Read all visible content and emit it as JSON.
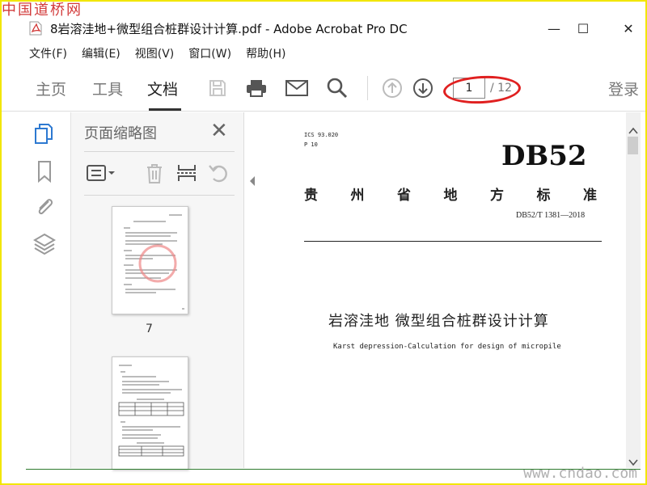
{
  "watermark": {
    "top": "中国道桥网",
    "bottom": "www.cndao.com"
  },
  "window": {
    "title": "8岩溶洼地+微型组合桩群设计计算.pdf - Adobe Acrobat Pro DC",
    "minimize": "—",
    "maximize": "☐",
    "close": "✕"
  },
  "menu": [
    "文件(F)",
    "编辑(E)",
    "视图(V)",
    "窗口(W)",
    "帮助(H)"
  ],
  "toolbar": {
    "tabs": [
      "主页",
      "工具",
      "文档"
    ],
    "active_tab": "文档",
    "current_page": "1",
    "total_pages": "/ 12",
    "login": "登录",
    "icons": [
      "save-icon",
      "print-icon",
      "email-icon",
      "search-icon",
      "page-up-icon",
      "page-down-icon"
    ]
  },
  "rail": {
    "icons": [
      "page-thumbnails-icon",
      "bookmarks-icon",
      "attachments-icon",
      "layers-icon"
    ]
  },
  "panel": {
    "title": "页面缩略图",
    "close": "✕",
    "thumb_label": "7",
    "tools": [
      "options-menu-icon",
      "delete-icon",
      "insert-page-icon",
      "rotate-icon"
    ]
  },
  "document": {
    "ics": "ICS 93.020",
    "p": "P 10",
    "code_big": "DB52",
    "std_name_chars": [
      "贵",
      "州",
      "省",
      "地",
      "方",
      "标",
      "准"
    ],
    "std_code": "DB52/T 1381—2018",
    "title_cn": "岩溶洼地 微型组合桩群设计计算",
    "title_en": "Karst depression-Calculation for design of micropile"
  }
}
